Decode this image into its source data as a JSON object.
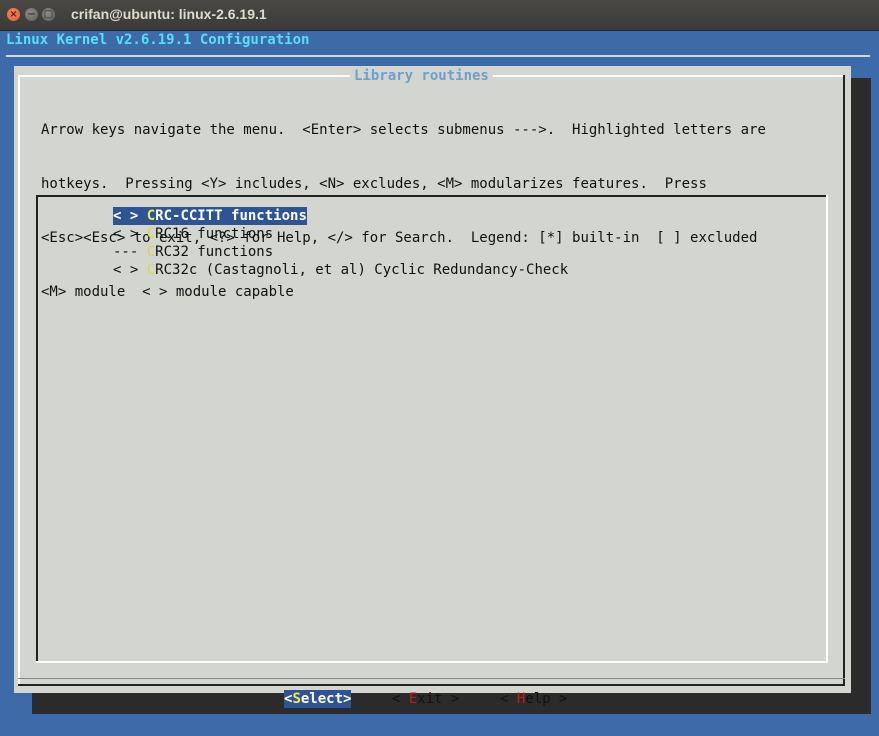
{
  "window": {
    "title": "crifan@ubuntu: linux-2.6.19.1",
    "close_glyph": "×",
    "minimize_glyph": "−",
    "maximize_glyph": "□"
  },
  "app": {
    "title": "Linux Kernel v2.6.19.1 Configuration"
  },
  "dialog": {
    "title": "Library routines",
    "help_lines": [
      "Arrow keys navigate the menu.  <Enter> selects submenus --->.  Highlighted letters are",
      "hotkeys.  Pressing <Y> includes, <N> excludes, <M> modularizes features.  Press",
      "<Esc><Esc> to exit, <?> for Help, </> for Search.  Legend: [*] built-in  [ ] excluded",
      "<M> module  < > module capable"
    ],
    "items": [
      {
        "prefix": "< > ",
        "hotkey": "C",
        "rest": "RC-CCITT functions",
        "selected": true
      },
      {
        "prefix": "< > ",
        "hotkey": "C",
        "rest": "RC16 functions",
        "selected": false
      },
      {
        "prefix": "--- ",
        "hotkey": "C",
        "rest": "RC32 functions",
        "selected": false
      },
      {
        "prefix": "< > ",
        "hotkey": "C",
        "rest": "RC32c (Castagnoli, et al) Cyclic Redundancy-Check",
        "selected": false
      }
    ],
    "buttons": {
      "select": {
        "open": "<",
        "hotkey": "S",
        "rest": "elect>"
      },
      "exit": {
        "open": "< ",
        "hotkey": "E",
        "rest": "xit >"
      },
      "help": {
        "open": "< ",
        "hotkey": "H",
        "rest": "elp >"
      }
    }
  },
  "colors": {
    "terminal_bg": "#3d6aa9",
    "dialog_bg": "#d3d6cf",
    "selection_bg": "#2e5496",
    "title_cyan": "#57e0f5",
    "hotkey_yellow": "#f1e94a",
    "hotkey_red": "#c41a1a"
  }
}
